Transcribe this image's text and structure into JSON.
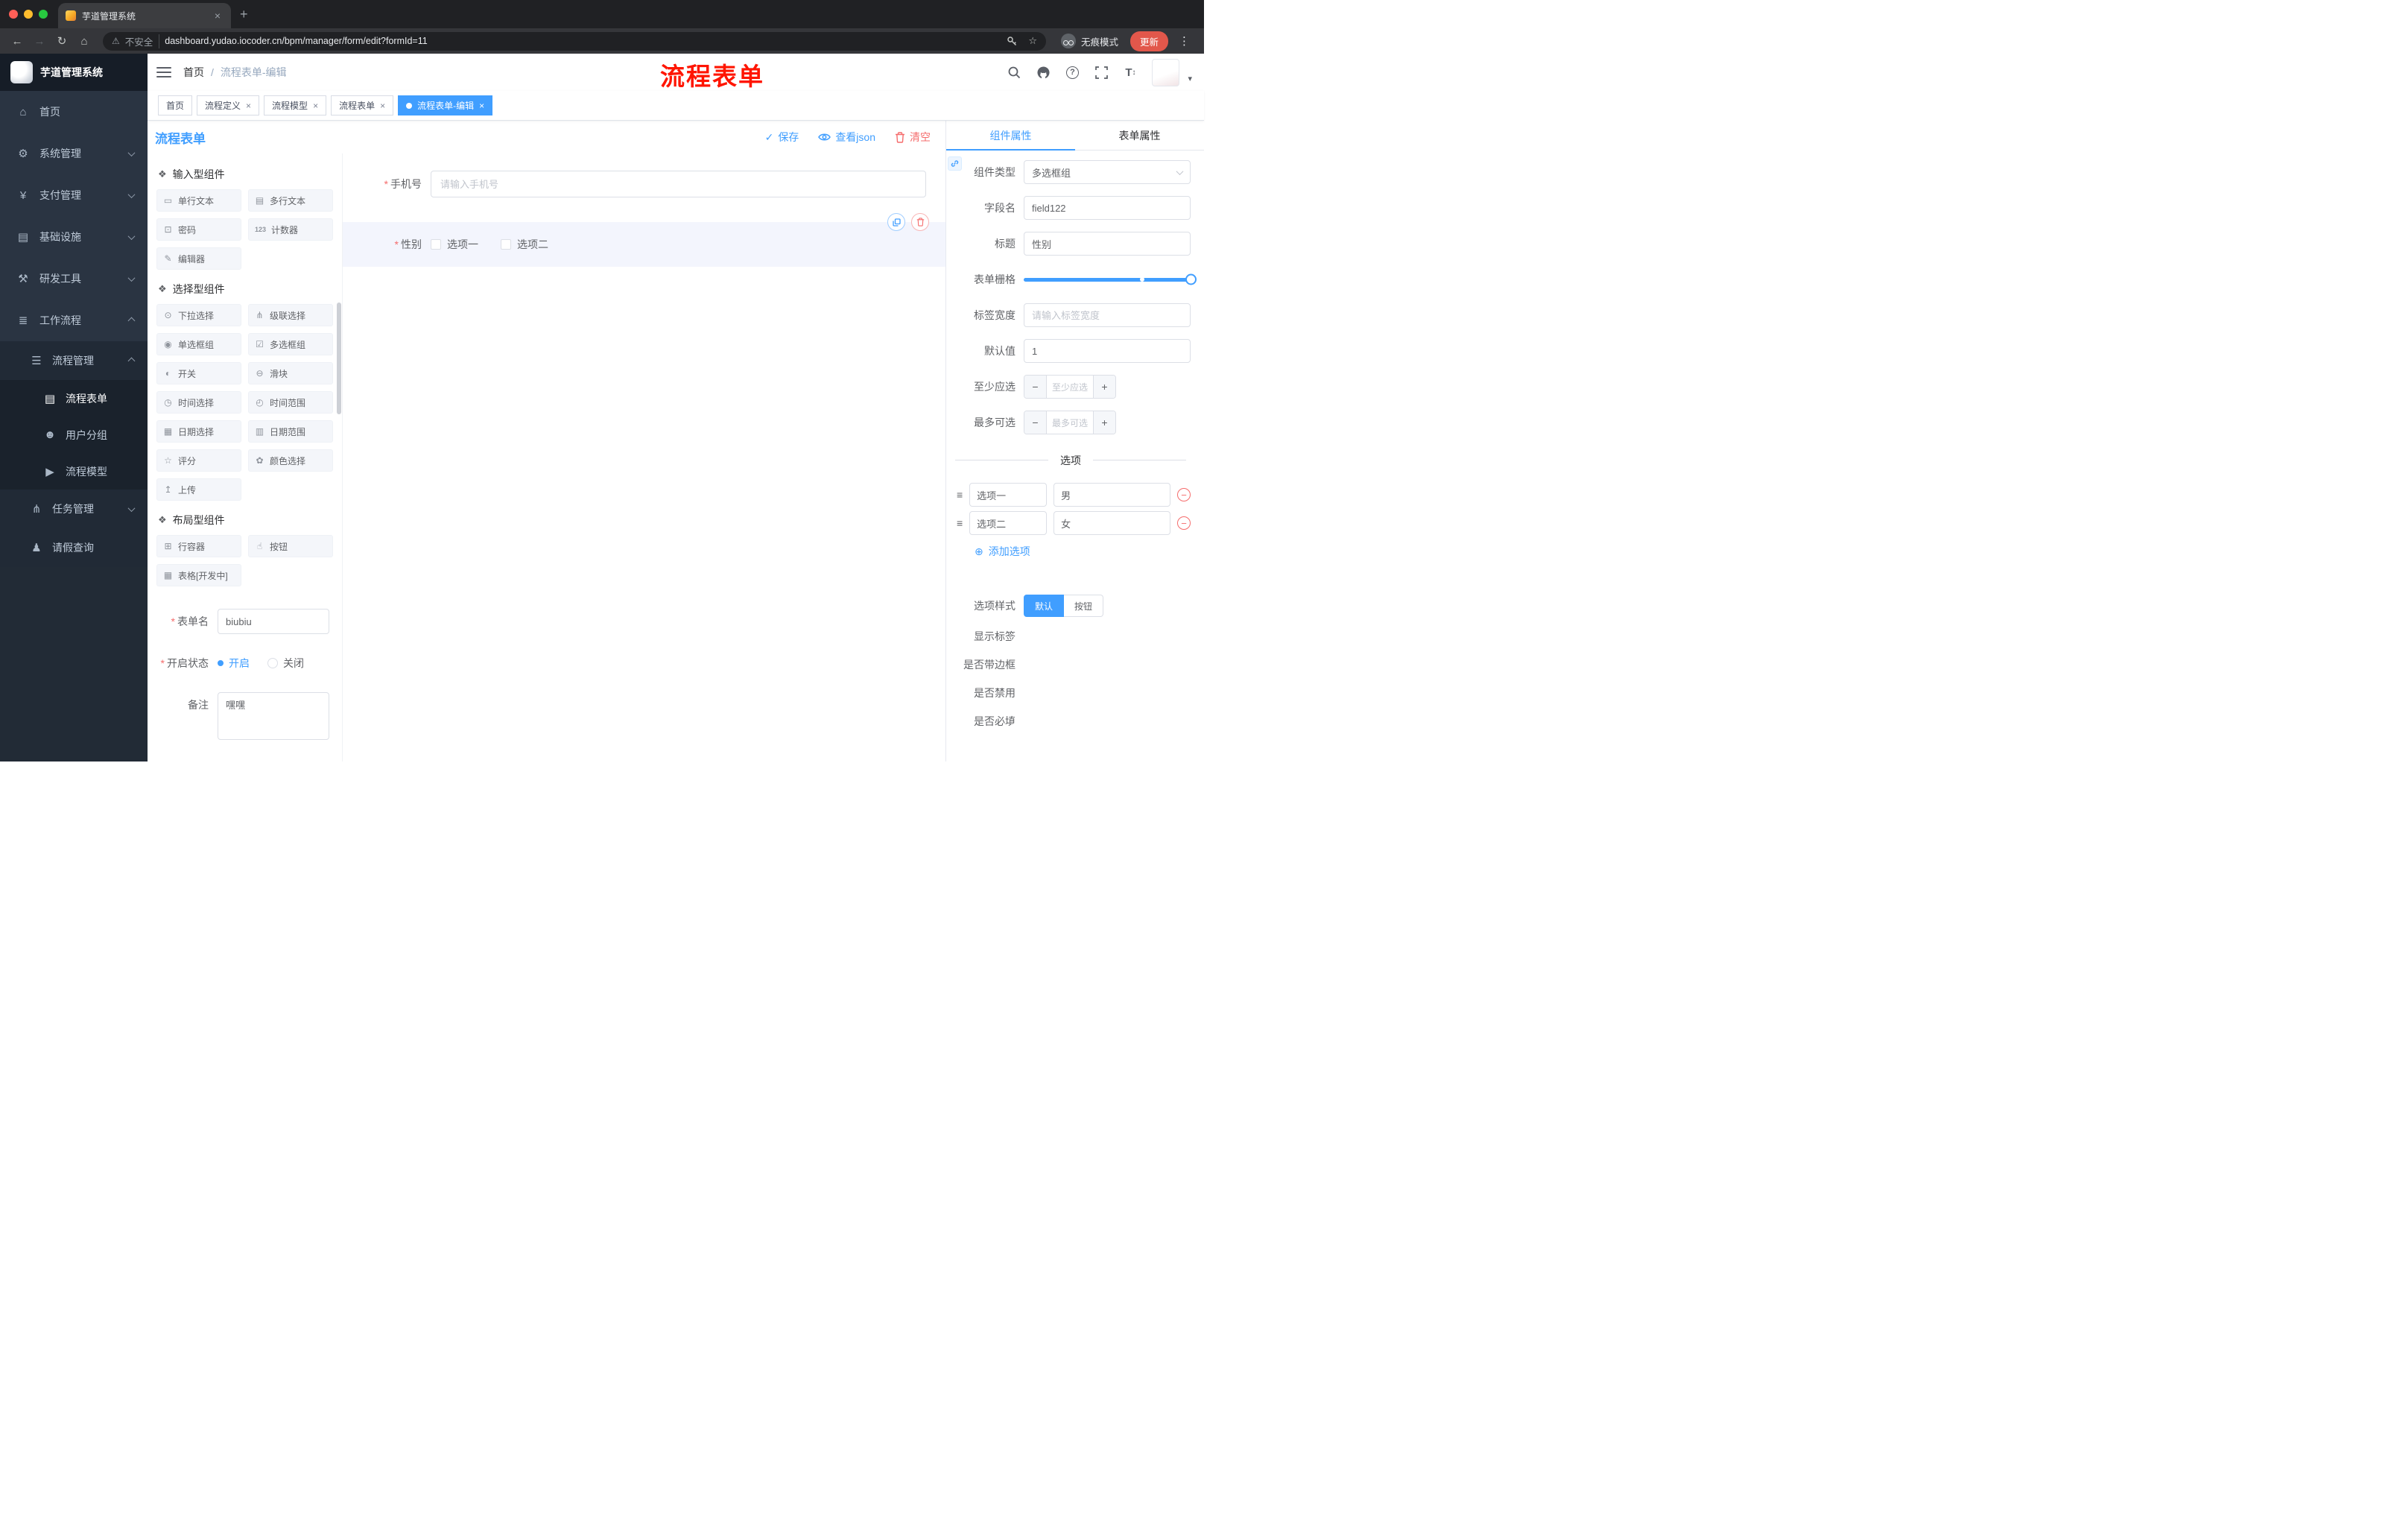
{
  "colors": {
    "accent": "#409eff",
    "danger": "#f56c6c",
    "annotation": "#ff1500",
    "sidebar_bg": "#2a3442",
    "chrome_bg": "#202124"
  },
  "icons": {
    "back": "←",
    "forward": "→",
    "reload": "↻",
    "home": "⌂",
    "warning": "⚠",
    "star": "☆",
    "dots": "⋮",
    "new_tab": "+",
    "close": "×",
    "check": "✓",
    "minus": "−",
    "plus": "+",
    "add_circle": "⊕",
    "caret_down": "▾",
    "drag_handle": "≡",
    "section_cube": "❖",
    "text_size": "T",
    "text_size_arrows": "↕",
    "question": "?"
  },
  "chrome": {
    "tab_title": "芋道管理系统",
    "security_label": "不安全",
    "url": "dashboard.yudao.iocoder.cn/bpm/manager/form/edit?formId=11",
    "incognito_label": "无痕模式",
    "update_label": "更新"
  },
  "sidebar": {
    "app_title": "芋道管理系统",
    "items": [
      {
        "label": "首页",
        "icon": "⌂"
      },
      {
        "label": "系统管理",
        "icon": "⚙"
      },
      {
        "label": "支付管理",
        "icon": "¥"
      },
      {
        "label": "基础设施",
        "icon": "▤"
      },
      {
        "label": "研发工具",
        "icon": "⚒"
      },
      {
        "label": "工作流程",
        "icon": "≣"
      }
    ],
    "workflow": {
      "process_management": {
        "label": "流程管理",
        "icon": "☰"
      },
      "process_children": [
        {
          "label": "流程表单",
          "icon": "▤",
          "active": true
        },
        {
          "label": "用户分组",
          "icon": "☻",
          "active": false
        },
        {
          "label": "流程模型",
          "icon": "▶",
          "active": false
        }
      ],
      "task_management": {
        "label": "任务管理",
        "icon": "⋔"
      },
      "leave_query": {
        "label": "请假查询",
        "icon": "♟"
      }
    }
  },
  "header": {
    "breadcrumb_home": "首页",
    "breadcrumb_sep": "/",
    "breadcrumb_current": "流程表单-编辑",
    "annotation": "流程表单"
  },
  "page_tabs": [
    {
      "label": "首页",
      "closable": false,
      "active": false
    },
    {
      "label": "流程定义",
      "closable": true,
      "active": false
    },
    {
      "label": "流程模型",
      "closable": true,
      "active": false
    },
    {
      "label": "流程表单",
      "closable": true,
      "active": false
    },
    {
      "label": "流程表单-编辑",
      "closable": true,
      "active": true
    }
  ],
  "designer": {
    "title": "流程表单",
    "save_label": "保存",
    "view_json_label": "查看json",
    "clear_label": "清空"
  },
  "palette": {
    "groups": [
      {
        "title": "输入型组件",
        "items": [
          {
            "label": "单行文本",
            "icon": "▭"
          },
          {
            "label": "多行文本",
            "icon": "▤"
          },
          {
            "label": "密码",
            "icon": "⊡"
          },
          {
            "label": "计数器",
            "icon": "123"
          },
          {
            "label": "编辑器",
            "icon": "✎"
          }
        ]
      },
      {
        "title": "选择型组件",
        "items": [
          {
            "label": "下拉选择",
            "icon": "⊙"
          },
          {
            "label": "级联选择",
            "icon": "⋔"
          },
          {
            "label": "单选框组",
            "icon": "◉"
          },
          {
            "label": "多选框组",
            "icon": "☑"
          },
          {
            "label": "开关",
            "icon": "◐"
          },
          {
            "label": "滑块",
            "icon": "⊖"
          },
          {
            "label": "时间选择",
            "icon": "◷"
          },
          {
            "label": "时间范围",
            "icon": "◴"
          },
          {
            "label": "日期选择",
            "icon": "▦"
          },
          {
            "label": "日期范围",
            "icon": "▥"
          },
          {
            "label": "评分",
            "icon": "☆"
          },
          {
            "label": "颜色选择",
            "icon": "✿"
          },
          {
            "label": "上传",
            "icon": "↥"
          }
        ]
      },
      {
        "title": "布局型组件",
        "items": [
          {
            "label": "行容器",
            "icon": "⊞"
          },
          {
            "label": "按钮",
            "icon": "☝"
          },
          {
            "label": "表格[开发中]",
            "icon": "▦"
          }
        ]
      }
    ],
    "meta": {
      "name_label": "表单名",
      "name_value": "biubiu",
      "status_label": "开启状态",
      "status_on": "开启",
      "status_off": "关闭",
      "status_selected": "开启",
      "remark_label": "备注",
      "remark_value": "嘿嘿"
    }
  },
  "canvas": {
    "phone_field": {
      "label": "手机号",
      "placeholder": "请输入手机号",
      "required": true
    },
    "gender_field": {
      "label": "性别",
      "required": true,
      "selected": true,
      "options": [
        {
          "label": "选项一",
          "checked": false
        },
        {
          "label": "选项二",
          "checked": false
        }
      ]
    }
  },
  "properties": {
    "tab_component": "组件属性",
    "tab_form": "表单属性",
    "component_type": {
      "label": "组件类型",
      "value": "多选框组"
    },
    "field_name": {
      "label": "字段名",
      "value": "field122"
    },
    "title": {
      "label": "标题",
      "value": "性别"
    },
    "form_grid": {
      "label": "表单栅格",
      "value": 24
    },
    "label_width": {
      "label": "标签宽度",
      "placeholder": "请输入标签宽度"
    },
    "default_value": {
      "label": "默认值",
      "value": "1"
    },
    "min_select": {
      "label": "至少应选",
      "placeholder": "至少应选"
    },
    "max_select": {
      "label": "最多可选",
      "placeholder": "最多可选"
    },
    "options_divider": "选项",
    "options": [
      {
        "name": "选项一",
        "value": "男"
      },
      {
        "name": "选项二",
        "value": "女"
      }
    ],
    "add_option_label": "添加选项",
    "option_style": {
      "label": "选项样式",
      "default_label": "默认",
      "button_label": "按钮",
      "selected": "默认"
    },
    "show_label": {
      "label": "显示标签",
      "on": true
    },
    "with_border": {
      "label": "是否带边框",
      "on": false
    },
    "disabled": {
      "label": "是否禁用",
      "on": false
    },
    "required": {
      "label": "是否必填",
      "on": true
    }
  }
}
